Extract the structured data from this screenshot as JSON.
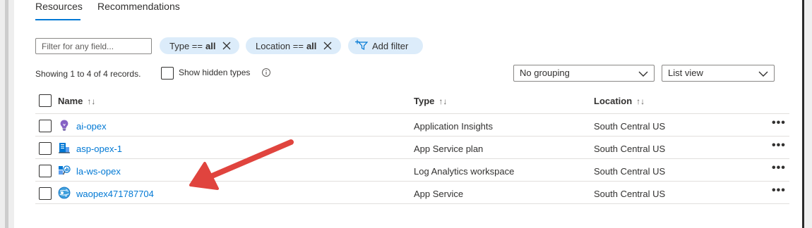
{
  "tabs": [
    {
      "label": "Resources",
      "active": true
    },
    {
      "label": "Recommendations",
      "active": false
    }
  ],
  "filters": {
    "search_placeholder": "Filter for any field...",
    "pills": [
      {
        "key": "Type ==",
        "value": "all"
      },
      {
        "key": "Location ==",
        "value": "all"
      }
    ],
    "add_filter_label": "Add filter"
  },
  "summary": {
    "showing_text": "Showing 1 to 4 of 4 records.",
    "show_hidden_label": "Show hidden types"
  },
  "grouping": {
    "selected": "No grouping"
  },
  "view": {
    "selected": "List view"
  },
  "columns": {
    "name": "Name",
    "type": "Type",
    "location": "Location",
    "sort_glyph": "↑↓"
  },
  "rows": [
    {
      "name": "ai-opex",
      "type": "Application Insights",
      "location": "South Central US",
      "icon": "application-insights-icon"
    },
    {
      "name": "asp-opex-1",
      "type": "App Service plan",
      "location": "South Central US",
      "icon": "app-service-plan-icon"
    },
    {
      "name": "la-ws-opex",
      "type": "Log Analytics workspace",
      "location": "South Central US",
      "icon": "log-analytics-icon"
    },
    {
      "name": "waopex471787704",
      "type": "App Service",
      "location": "South Central US",
      "icon": "app-service-icon"
    }
  ],
  "more_glyph": "•••",
  "colors": {
    "accent": "#0078d4",
    "pill_bg": "#dcecfa",
    "annotation_arrow": "#e0443e"
  }
}
